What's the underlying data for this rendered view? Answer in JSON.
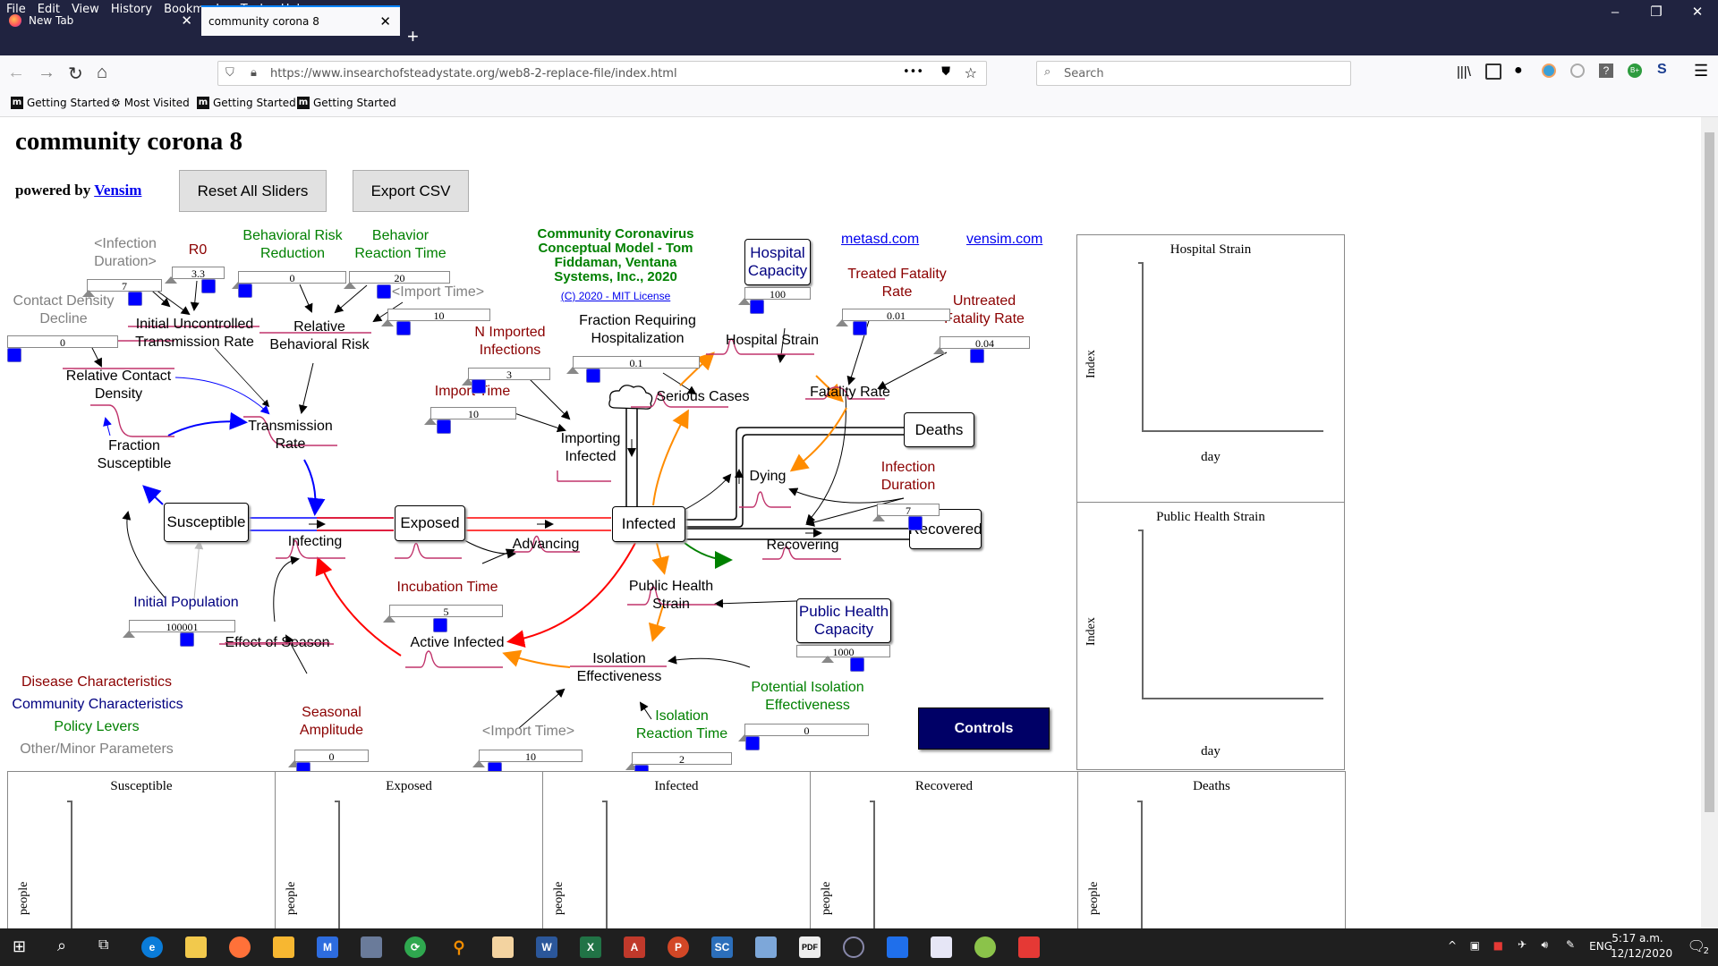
{
  "browser": {
    "menu": [
      "File",
      "Edit",
      "View",
      "History",
      "Bookmarks",
      "Tools",
      "Help"
    ],
    "tabs": [
      {
        "label": "New Tab"
      },
      {
        "label": "community corona 8"
      }
    ],
    "url": "https://www.insearchofsteadystate.org/web8-2-replace-file/index.html",
    "search_placeholder": "Search",
    "bookmarks": [
      "Getting Started",
      "Most Visited",
      "Getting Started",
      "Getting Started"
    ],
    "window_controls": [
      "–",
      "❐",
      "✕"
    ]
  },
  "page": {
    "title": "community corona 8",
    "powered_by": "powered by",
    "vensim_link": "Vensim",
    "reset_button": "Reset All Sliders",
    "export_button": "Export CSV",
    "credit": [
      "Community Coronavirus",
      "Conceptual Model - Tom",
      "Fiddaman, Ventana",
      "Systems, Inc., 2020"
    ],
    "license_link": "(C) 2020 - MIT License",
    "links": {
      "metasd": "metasd.com",
      "vensim": "vensim.com"
    },
    "controls_button": "Controls",
    "legend": [
      "Disease Characteristics",
      "Community Characteristics",
      "Policy Levers",
      "Other/Minor Parameters"
    ],
    "colors": {
      "disease": "#8b0000",
      "community": "#000080",
      "policy": "#008000",
      "other": "#808080",
      "slider_knob": "#0000ff",
      "controls_bg": "#000066"
    }
  },
  "diagram": {
    "stocks": {
      "susceptible": "Susceptible",
      "exposed": "Exposed",
      "infected": "Infected",
      "deaths": "Deaths",
      "recovered": "Recovered",
      "hospital_capacity": [
        "Hospital",
        "Capacity"
      ],
      "public_health_capacity": [
        "Public Health",
        "Capacity"
      ]
    },
    "variables": {
      "infection_duration_shadow": [
        "<Infection",
        "Duration>"
      ],
      "r0": "R0",
      "behavioral_risk_reduction": [
        "Behavioral Risk",
        "Reduction"
      ],
      "behavior_reaction_time": [
        "Behavior",
        "Reaction Time"
      ],
      "import_time_shadow": "<Import Time>",
      "contact_density_decline": [
        "Contact Density",
        "Decline"
      ],
      "initial_uncontrolled_transmission_rate": [
        "Initial Uncontrolled",
        "Transmission Rate"
      ],
      "relative_behavioral_risk": [
        "Relative",
        "Behavioral Risk"
      ],
      "relative_contact_density": [
        "Relative Contact",
        "Density"
      ],
      "transmission_rate": [
        "Transmission",
        "Rate"
      ],
      "fraction_susceptible": [
        "Fraction",
        "Susceptible"
      ],
      "infecting": "Infecting",
      "advancing": "Advancing",
      "initial_population": "Initial Population",
      "effect_of_season": "Effect of Season",
      "seasonal_amplitude": [
        "Seasonal",
        "Amplitude"
      ],
      "incubation_time": "Incubation Time",
      "active_infected": "Active Infected",
      "n_imported_infections": [
        "N Imported",
        "Infections"
      ],
      "import_time": "Import Time",
      "importing_infected": [
        "Importing",
        "Infected"
      ],
      "fraction_requiring_hospitalization": [
        "Fraction Requiring",
        "Hospitalization"
      ],
      "serious_cases": "Serious Cases",
      "hospital_strain": "Hospital Strain",
      "treated_fatality_rate": [
        "Treated Fatality",
        "Rate"
      ],
      "untreated_fatality_rate": [
        "Untreated",
        "Fatality Rate"
      ],
      "fatality_rate": "Fatality Rate",
      "dying": "Dying",
      "infection_duration": [
        "Infection",
        "Duration"
      ],
      "recovering": "Recovering",
      "public_health_strain": [
        "Public Health",
        "Strain"
      ],
      "isolation_effectiveness": [
        "Isolation",
        "Effectiveness"
      ],
      "potential_isolation_effectiveness": [
        "Potential Isolation",
        "Effectiveness"
      ],
      "isolation_reaction_time": [
        "Isolation",
        "Reaction Time"
      ],
      "import_time_shadow2": "<Import Time>"
    },
    "sliders": {
      "infection_duration_shadow": "7",
      "r0": "3.3",
      "behavioral_risk_reduction": "0",
      "behavior_reaction_time": "20",
      "import_time_shadow": "10",
      "contact_density_decline": "0",
      "n_imported_infections": "3",
      "import_time": "10",
      "fraction_requiring_hospitalization": "0.1",
      "hospital_capacity": "100",
      "treated_fatality_rate": "0.01",
      "untreated_fatality_rate": "0.04",
      "infection_duration": "7",
      "initial_population": "100001",
      "incubation_time": "5",
      "public_health_capacity": "1000",
      "potential_isolation_effectiveness": "0",
      "seasonal_amplitude": "0",
      "import_time_shadow2": "10",
      "isolation_reaction_time": "2"
    }
  },
  "chart_data": [
    {
      "type": "line",
      "title": "Hospital Strain",
      "xlabel": "day",
      "ylabel": "Index",
      "series": []
    },
    {
      "type": "line",
      "title": "Public Health Strain",
      "xlabel": "day",
      "ylabel": "Index",
      "series": []
    },
    {
      "type": "line",
      "title": "Susceptible",
      "xlabel": "",
      "ylabel": "people",
      "series": []
    },
    {
      "type": "line",
      "title": "Exposed",
      "xlabel": "",
      "ylabel": "people",
      "series": []
    },
    {
      "type": "line",
      "title": "Infected",
      "xlabel": "",
      "ylabel": "people",
      "series": []
    },
    {
      "type": "line",
      "title": "Recovered",
      "xlabel": "",
      "ylabel": "people",
      "series": []
    },
    {
      "type": "line",
      "title": "Deaths",
      "xlabel": "",
      "ylabel": "people",
      "series": []
    }
  ],
  "taskbar": {
    "time": "5:17 a.m.",
    "date": "12/12/2020",
    "lang": "ENG",
    "notifications": "2"
  }
}
